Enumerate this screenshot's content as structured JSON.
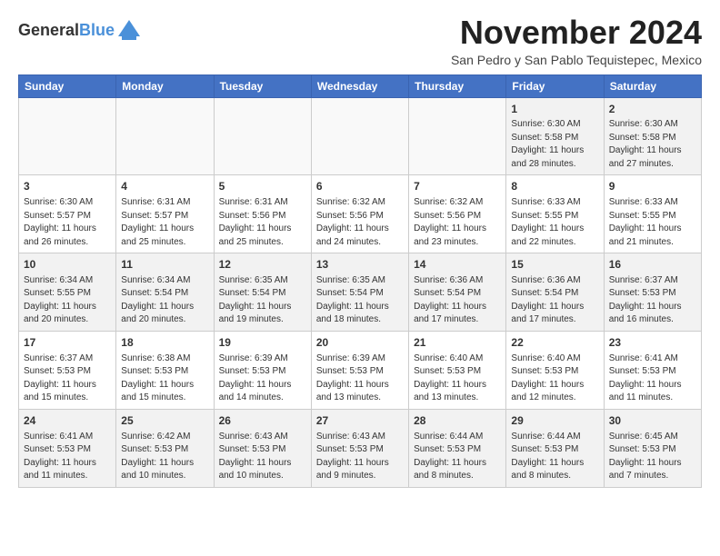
{
  "logo": {
    "general": "General",
    "blue": "Blue"
  },
  "title": "November 2024",
  "location": "San Pedro y San Pablo Tequistepec, Mexico",
  "days_of_week": [
    "Sunday",
    "Monday",
    "Tuesday",
    "Wednesday",
    "Thursday",
    "Friday",
    "Saturday"
  ],
  "weeks": [
    [
      {
        "day": "",
        "info": ""
      },
      {
        "day": "",
        "info": ""
      },
      {
        "day": "",
        "info": ""
      },
      {
        "day": "",
        "info": ""
      },
      {
        "day": "",
        "info": ""
      },
      {
        "day": "1",
        "info": "Sunrise: 6:30 AM\nSunset: 5:58 PM\nDaylight: 11 hours\nand 28 minutes."
      },
      {
        "day": "2",
        "info": "Sunrise: 6:30 AM\nSunset: 5:58 PM\nDaylight: 11 hours\nand 27 minutes."
      }
    ],
    [
      {
        "day": "3",
        "info": "Sunrise: 6:30 AM\nSunset: 5:57 PM\nDaylight: 11 hours\nand 26 minutes."
      },
      {
        "day": "4",
        "info": "Sunrise: 6:31 AM\nSunset: 5:57 PM\nDaylight: 11 hours\nand 25 minutes."
      },
      {
        "day": "5",
        "info": "Sunrise: 6:31 AM\nSunset: 5:56 PM\nDaylight: 11 hours\nand 25 minutes."
      },
      {
        "day": "6",
        "info": "Sunrise: 6:32 AM\nSunset: 5:56 PM\nDaylight: 11 hours\nand 24 minutes."
      },
      {
        "day": "7",
        "info": "Sunrise: 6:32 AM\nSunset: 5:56 PM\nDaylight: 11 hours\nand 23 minutes."
      },
      {
        "day": "8",
        "info": "Sunrise: 6:33 AM\nSunset: 5:55 PM\nDaylight: 11 hours\nand 22 minutes."
      },
      {
        "day": "9",
        "info": "Sunrise: 6:33 AM\nSunset: 5:55 PM\nDaylight: 11 hours\nand 21 minutes."
      }
    ],
    [
      {
        "day": "10",
        "info": "Sunrise: 6:34 AM\nSunset: 5:55 PM\nDaylight: 11 hours\nand 20 minutes."
      },
      {
        "day": "11",
        "info": "Sunrise: 6:34 AM\nSunset: 5:54 PM\nDaylight: 11 hours\nand 20 minutes."
      },
      {
        "day": "12",
        "info": "Sunrise: 6:35 AM\nSunset: 5:54 PM\nDaylight: 11 hours\nand 19 minutes."
      },
      {
        "day": "13",
        "info": "Sunrise: 6:35 AM\nSunset: 5:54 PM\nDaylight: 11 hours\nand 18 minutes."
      },
      {
        "day": "14",
        "info": "Sunrise: 6:36 AM\nSunset: 5:54 PM\nDaylight: 11 hours\nand 17 minutes."
      },
      {
        "day": "15",
        "info": "Sunrise: 6:36 AM\nSunset: 5:54 PM\nDaylight: 11 hours\nand 17 minutes."
      },
      {
        "day": "16",
        "info": "Sunrise: 6:37 AM\nSunset: 5:53 PM\nDaylight: 11 hours\nand 16 minutes."
      }
    ],
    [
      {
        "day": "17",
        "info": "Sunrise: 6:37 AM\nSunset: 5:53 PM\nDaylight: 11 hours\nand 15 minutes."
      },
      {
        "day": "18",
        "info": "Sunrise: 6:38 AM\nSunset: 5:53 PM\nDaylight: 11 hours\nand 15 minutes."
      },
      {
        "day": "19",
        "info": "Sunrise: 6:39 AM\nSunset: 5:53 PM\nDaylight: 11 hours\nand 14 minutes."
      },
      {
        "day": "20",
        "info": "Sunrise: 6:39 AM\nSunset: 5:53 PM\nDaylight: 11 hours\nand 13 minutes."
      },
      {
        "day": "21",
        "info": "Sunrise: 6:40 AM\nSunset: 5:53 PM\nDaylight: 11 hours\nand 13 minutes."
      },
      {
        "day": "22",
        "info": "Sunrise: 6:40 AM\nSunset: 5:53 PM\nDaylight: 11 hours\nand 12 minutes."
      },
      {
        "day": "23",
        "info": "Sunrise: 6:41 AM\nSunset: 5:53 PM\nDaylight: 11 hours\nand 11 minutes."
      }
    ],
    [
      {
        "day": "24",
        "info": "Sunrise: 6:41 AM\nSunset: 5:53 PM\nDaylight: 11 hours\nand 11 minutes."
      },
      {
        "day": "25",
        "info": "Sunrise: 6:42 AM\nSunset: 5:53 PM\nDaylight: 11 hours\nand 10 minutes."
      },
      {
        "day": "26",
        "info": "Sunrise: 6:43 AM\nSunset: 5:53 PM\nDaylight: 11 hours\nand 10 minutes."
      },
      {
        "day": "27",
        "info": "Sunrise: 6:43 AM\nSunset: 5:53 PM\nDaylight: 11 hours\nand 9 minutes."
      },
      {
        "day": "28",
        "info": "Sunrise: 6:44 AM\nSunset: 5:53 PM\nDaylight: 11 hours\nand 8 minutes."
      },
      {
        "day": "29",
        "info": "Sunrise: 6:44 AM\nSunset: 5:53 PM\nDaylight: 11 hours\nand 8 minutes."
      },
      {
        "day": "30",
        "info": "Sunrise: 6:45 AM\nSunset: 5:53 PM\nDaylight: 11 hours\nand 7 minutes."
      }
    ]
  ]
}
